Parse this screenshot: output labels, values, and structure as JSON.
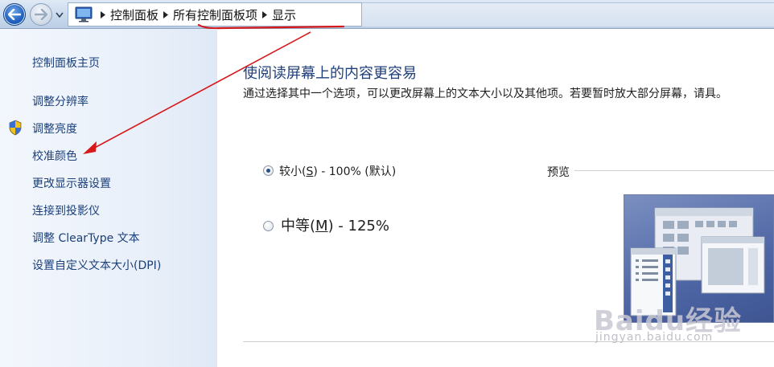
{
  "breadcrumb": {
    "items": [
      "控制面板",
      "所有控制面板项",
      "显示"
    ]
  },
  "sidebar": {
    "home": "控制面板主页",
    "items": [
      {
        "label": "调整分辨率"
      },
      {
        "label": "调整亮度"
      },
      {
        "label": "校准颜色"
      },
      {
        "label": "更改显示器设置"
      },
      {
        "label": "连接到投影仪"
      },
      {
        "label": "调整 ClearType 文本"
      },
      {
        "label": "设置自定义文本大小(DPI)"
      }
    ]
  },
  "main": {
    "title": "使阅读屏幕上的内容更容易",
    "description": "通过选择其中一个选项，可以更改屏幕上的文本大小以及其他项。若要暂时放大部分屏幕，请具。",
    "options": [
      {
        "label_pre": "较小(",
        "key": "S",
        "label_post": ") - 100% (默认)",
        "selected": true
      },
      {
        "label_pre": "中等(",
        "key": "M",
        "label_post": ") - 125%",
        "selected": false
      }
    ],
    "preview_label": "预览"
  },
  "watermark": {
    "brand": "Baidu经验",
    "url": "jingyan.baidu.com"
  },
  "colors": {
    "annotation": "#d7191c",
    "link": "#1a3f7a",
    "title": "#1f3e7c"
  },
  "icons": [
    "back-arrow-icon",
    "forward-arrow-icon",
    "recent-pages-icon",
    "control-panel-icon",
    "breadcrumb-separator-icon",
    "uac-shield-icon"
  ]
}
